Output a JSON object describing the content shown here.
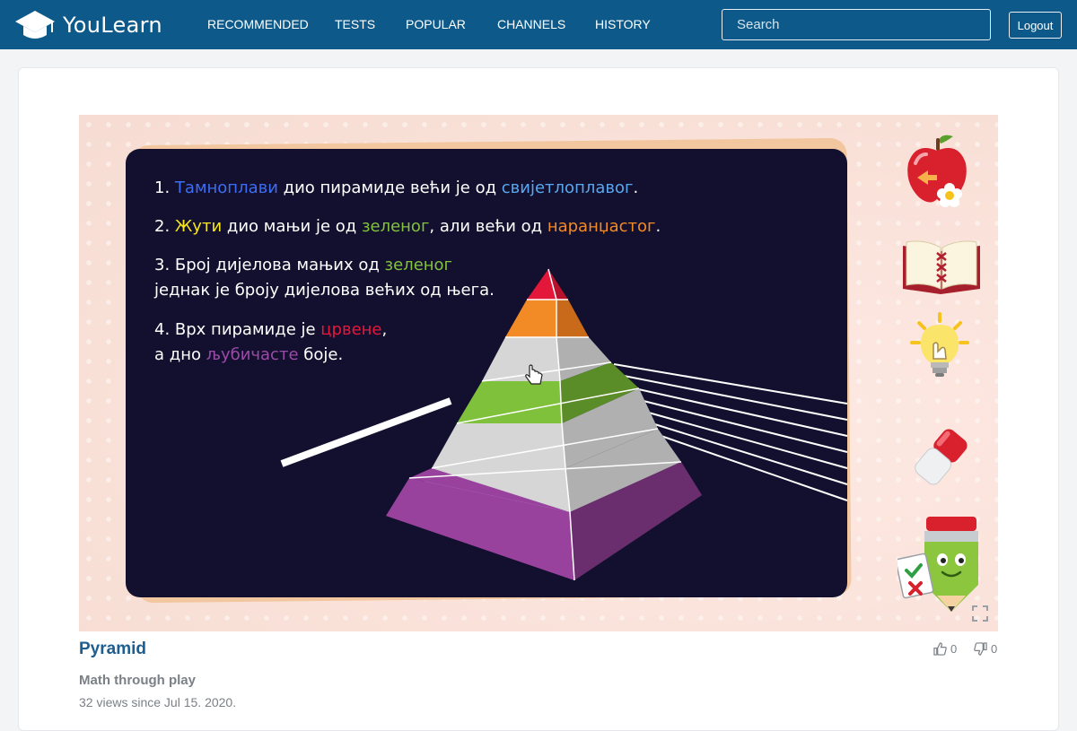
{
  "brand": {
    "name": "YouLearn"
  },
  "nav": {
    "items": [
      "RECOMMENDED",
      "TESTS",
      "POPULAR",
      "CHANNELS",
      "HISTORY"
    ],
    "search_placeholder": "Search",
    "logout_label": "Logout"
  },
  "video": {
    "lines": {
      "l1_num": "1.",
      "l1_a": "Тамноплави",
      "l1_b": " дио пирамиде већи је од ",
      "l1_c": "свијетлоплавог",
      "l1_d": ".",
      "l2_num": "2.",
      "l2_a": "Жути",
      "l2_b": " дио мањи је од ",
      "l2_c": "зеленог",
      "l2_d": ", али већи од ",
      "l2_e": "наранџастог",
      "l2_f": ".",
      "l3_a": "3. Број дијелова мањих од ",
      "l3_b": "зеленог",
      "l3_c": "једнак је броју дијелова већих од њега.",
      "l4_a": "4. Врх пирамиде је ",
      "l4_b": "црвене",
      "l4_c": ",",
      "l4_d": "а дно ",
      "l4_e": "љубичасте",
      "l4_f": " боје."
    },
    "colors": {
      "board": "#12102e",
      "blue": "#3d6df2",
      "light_blue": "#5aa7f0",
      "yellow": "#f6e61f",
      "green": "#83c23c",
      "orange": "#f28a25",
      "red": "#e6173b",
      "purple": "#9c4aa8"
    },
    "side_icons": [
      "apple-back-icon",
      "book-icon",
      "lightbulb-hint-icon",
      "eraser-icon",
      "pencil-mascot-icon"
    ]
  },
  "meta": {
    "title": "Pyramid",
    "channel": "Math through play",
    "views": "32 views since Jul 15. 2020.",
    "likes": "0",
    "dislikes": "0"
  }
}
